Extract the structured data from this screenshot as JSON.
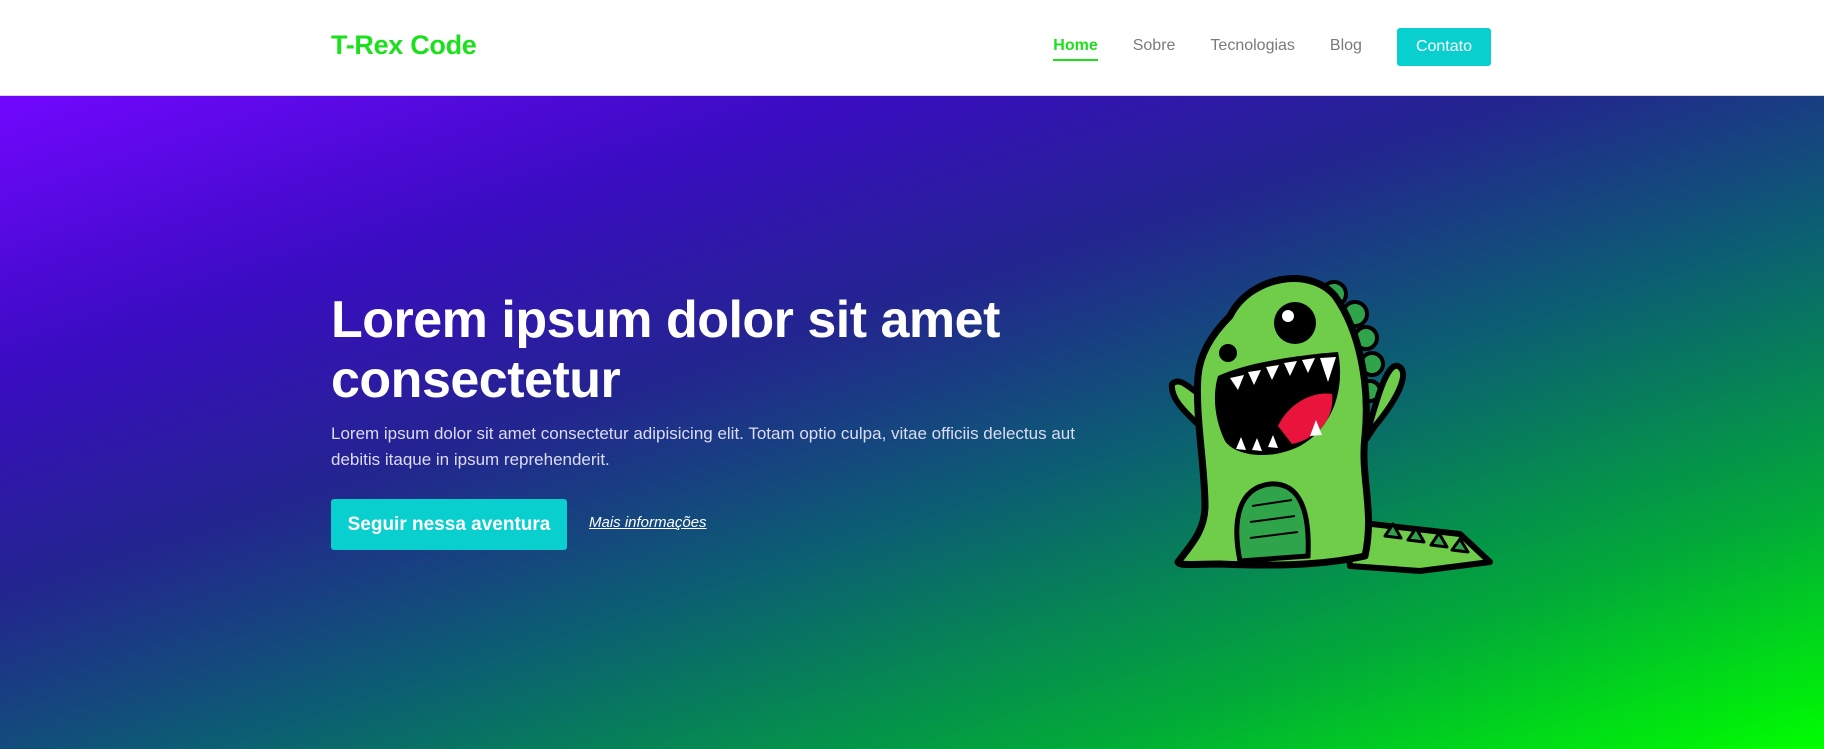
{
  "header": {
    "logo": "T-Rex Code",
    "nav": [
      {
        "label": "Home",
        "active": true
      },
      {
        "label": "Sobre",
        "active": false
      },
      {
        "label": "Tecnologias",
        "active": false
      },
      {
        "label": "Blog",
        "active": false
      }
    ],
    "contact_label": "Contato"
  },
  "hero": {
    "title": "Lorem ipsum dolor sit amet consectetur",
    "text": "Lorem ipsum dolor sit amet consectetur adipisicing elit. Totam optio culpa, vitae officiis delectus aut debitis itaque in ipsum reprehenderit.",
    "cta_label": "Seguir nessa aventura",
    "more_label": "Mais informações",
    "illustration": "dinosaur-illustration"
  },
  "colors": {
    "brand_green": "#1be01b",
    "accent_cyan": "#0acfcf",
    "gradient_start": "#7207ff",
    "gradient_end": "#00ff00"
  }
}
